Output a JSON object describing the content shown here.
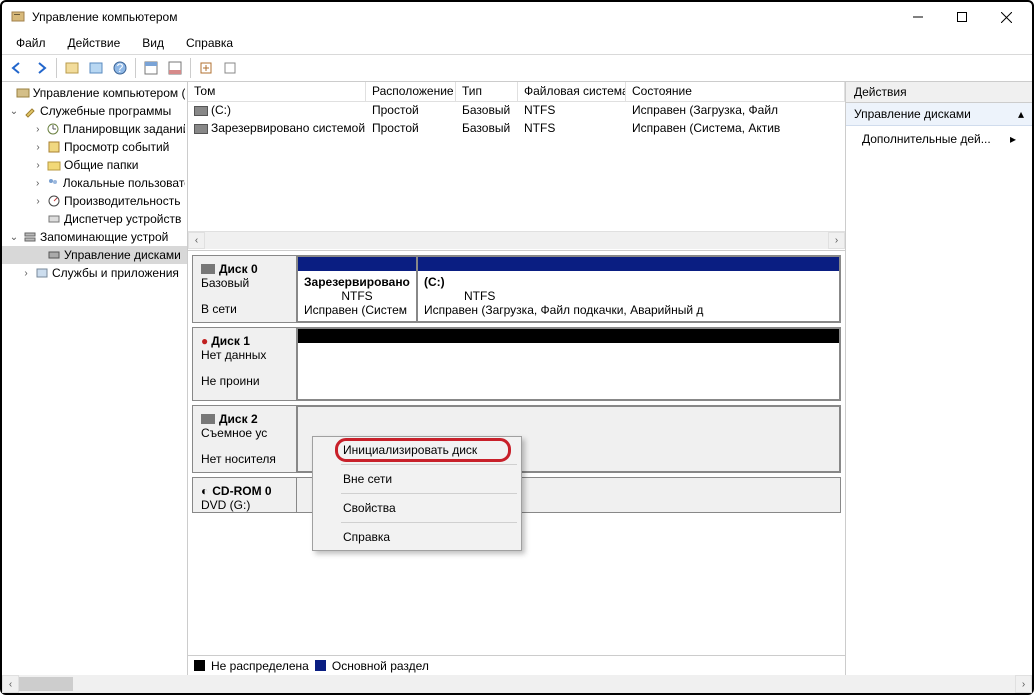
{
  "window": {
    "title": "Управление компьютером"
  },
  "menu": {
    "file": "Файл",
    "action": "Действие",
    "view": "Вид",
    "help": "Справка"
  },
  "tree": {
    "root": "Управление компьютером (л",
    "system_tools": "Служебные программы",
    "scheduler": "Планировщик заданий",
    "eventviewer": "Просмотр событий",
    "shared": "Общие папки",
    "localusers": "Локальные пользовате",
    "perf": "Производительность",
    "devmgr": "Диспетчер устройств",
    "storage": "Запоминающие устрой",
    "diskmgmt": "Управление дисками",
    "services": "Службы и приложения"
  },
  "cols": {
    "vol": "Том",
    "layout": "Расположение",
    "type": "Тип",
    "fs": "Файловая система",
    "status": "Состояние"
  },
  "rows": [
    {
      "vol": "(C:)",
      "layout": "Простой",
      "type": "Базовый",
      "fs": "NTFS",
      "status": "Исправен (Загрузка, Файл"
    },
    {
      "vol": "Зарезервировано системой",
      "layout": "Простой",
      "type": "Базовый",
      "fs": "NTFS",
      "status": "Исправен (Система, Актив"
    }
  ],
  "disk0": {
    "title": "Диск 0",
    "type": "Базовый",
    "status": "В сети",
    "p1": {
      "name": "Зарезервировано",
      "fs": "NTFS",
      "stat": "Исправен (Систем"
    },
    "p2": {
      "name": "(C:)",
      "fs": "NTFS",
      "stat": "Исправен (Загрузка, Файл подкачки, Аварийный д"
    }
  },
  "disk1": {
    "title": "Диск 1",
    "type": "Нет данных",
    "status": "Не проини"
  },
  "disk2": {
    "title": "Диск 2",
    "type": "Съемное ус",
    "status": "Нет носителя"
  },
  "cdrom": {
    "title": "CD-ROM 0",
    "sub": "DVD (G:)"
  },
  "legend": {
    "unalloc": "Не распределена",
    "primary": "Основной раздел"
  },
  "actions": {
    "head": "Действия",
    "sub": "Управление дисками",
    "more": "Дополнительные дей..."
  },
  "ctx": {
    "init": "Инициализировать диск",
    "offline": "Вне сети",
    "props": "Свойства",
    "help": "Справка"
  }
}
